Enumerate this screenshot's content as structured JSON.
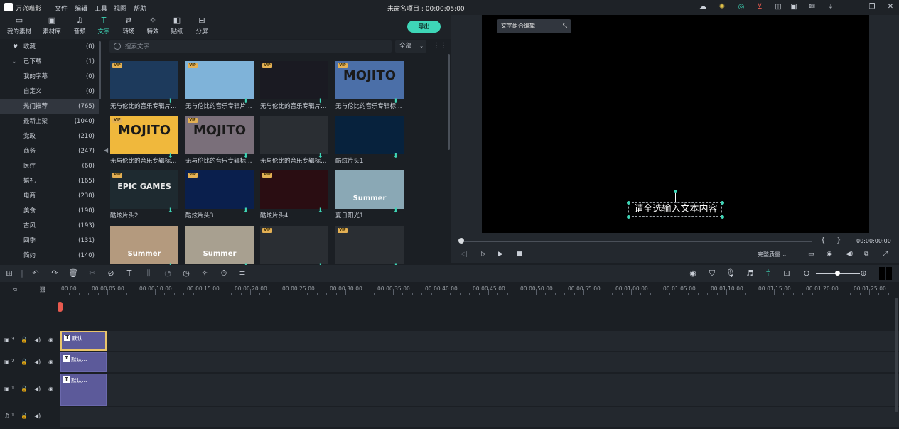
{
  "app": {
    "name": "万兴喵影",
    "project_title": "未命名项目 : 00:00:05:00"
  },
  "menu": [
    {
      "label": "文件"
    },
    {
      "label": "编辑"
    },
    {
      "label": "工具"
    },
    {
      "label": "视图"
    },
    {
      "label": "帮助"
    }
  ],
  "category_tabs": [
    {
      "label": "我的素材",
      "icon": "folder-icon"
    },
    {
      "label": "素材库",
      "icon": "image-icon"
    },
    {
      "label": "音频",
      "icon": "music-icon"
    },
    {
      "label": "文字",
      "icon": "text-icon",
      "active": true
    },
    {
      "label": "转场",
      "icon": "transition-icon"
    },
    {
      "label": "特效",
      "icon": "effects-icon"
    },
    {
      "label": "贴纸",
      "icon": "sticker-icon"
    },
    {
      "label": "分屏",
      "icon": "split-screen-icon"
    }
  ],
  "export_label": "导出",
  "sidebar": [
    {
      "label": "收藏",
      "count": "(0)",
      "icon": "heart-icon"
    },
    {
      "label": "已下载",
      "count": "(1)",
      "icon": "download-icon"
    },
    {
      "label": "我的字幕",
      "count": "(0)"
    },
    {
      "label": "自定义",
      "count": "(0)"
    },
    {
      "label": "热门推荐",
      "count": "(765)",
      "active": true
    },
    {
      "label": "最新上架",
      "count": "(1040)"
    },
    {
      "label": "党政",
      "count": "(210)"
    },
    {
      "label": "商务",
      "count": "(247)"
    },
    {
      "label": "医疗",
      "count": "(60)"
    },
    {
      "label": "婚礼",
      "count": "(165)"
    },
    {
      "label": "电商",
      "count": "(230)"
    },
    {
      "label": "美食",
      "count": "(190)"
    },
    {
      "label": "古风",
      "count": "(193)"
    },
    {
      "label": "四季",
      "count": "(131)"
    },
    {
      "label": "简约",
      "count": "(140)"
    }
  ],
  "search": {
    "placeholder": "搜索文字",
    "filter": "全部"
  },
  "library": [
    {
      "title": "无与伦比的音乐专辑片…",
      "vip": true,
      "bg": "#1d3a5c"
    },
    {
      "title": "无与伦比的音乐专辑片…",
      "vip": true,
      "bg": "#7fb3d9"
    },
    {
      "title": "无与伦比的音乐专辑片…",
      "vip": true,
      "bg": "#1a1a22"
    },
    {
      "title": "无与伦比的音乐专辑标…",
      "vip": true,
      "bg": "#4b6fa8",
      "text": "MOJITO"
    },
    {
      "title": "无与伦比的音乐专辑标…",
      "vip": true,
      "bg": "#f0b83c",
      "text": "MOJITO"
    },
    {
      "title": "无与伦比的音乐专辑标…",
      "vip": true,
      "bg": "#7a6f7a",
      "text": "MOJITO"
    },
    {
      "title": "无与伦比的音乐专辑标…",
      "vip": false,
      "bg": "#2a2e33"
    },
    {
      "title": "酷炫片头1",
      "vip": false,
      "bg": "#07223d"
    },
    {
      "title": "酷炫片头2",
      "vip": true,
      "bg": "#1e2a30",
      "text": "EPIC GAMES"
    },
    {
      "title": "酷炫片头3",
      "vip": true,
      "bg": "#0a1f4d"
    },
    {
      "title": "酷炫片头4",
      "vip": true,
      "bg": "#2a0d12"
    },
    {
      "title": "夏日阳光1",
      "vip": false,
      "bg": "#8aa8b5",
      "text": "Summer"
    },
    {
      "title": "",
      "vip": false,
      "bg": "#b49a7e",
      "text": "Summer"
    },
    {
      "title": "",
      "vip": false,
      "bg": "#a8a090",
      "text": "Summer"
    },
    {
      "title": "",
      "vip": true,
      "bg": "#2a2e33"
    },
    {
      "title": "",
      "vip": true,
      "bg": "#2a2e33"
    }
  ],
  "preview": {
    "combo_label": "文字组合编辑",
    "overlay_text": "请全选输入文本内容",
    "timecode": "00:00:00:00",
    "quality": "完整质量",
    "braces_left": "{",
    "braces_right": "}",
    "progress": 0.0
  },
  "timeline": {
    "ruler": [
      "00:00",
      "00:00:05:00",
      "00:00:10:00",
      "00:00:15:00",
      "00:00:20:00",
      "00:00:25:00",
      "00:00:30:00",
      "00:00:35:00",
      "00:00:40:00",
      "00:00:45:00",
      "00:00:50:00",
      "00:00:55:00",
      "00:01:00:00",
      "00:01:05:00",
      "00:01:10:00",
      "00:01:15:00",
      "00:01:20:00",
      "00:01:25:00"
    ],
    "tracks": [
      {
        "id": "3",
        "clip_label": "默认…"
      },
      {
        "id": "2",
        "clip_label": "默认…"
      },
      {
        "id": "1",
        "clip_label": "默认…"
      }
    ],
    "audio_track_id": "1"
  },
  "colors": {
    "accent": "#3ed6b7",
    "playhead": "#e85a4f",
    "clip": "#5c5a9a",
    "selection": "#e9c46a"
  }
}
